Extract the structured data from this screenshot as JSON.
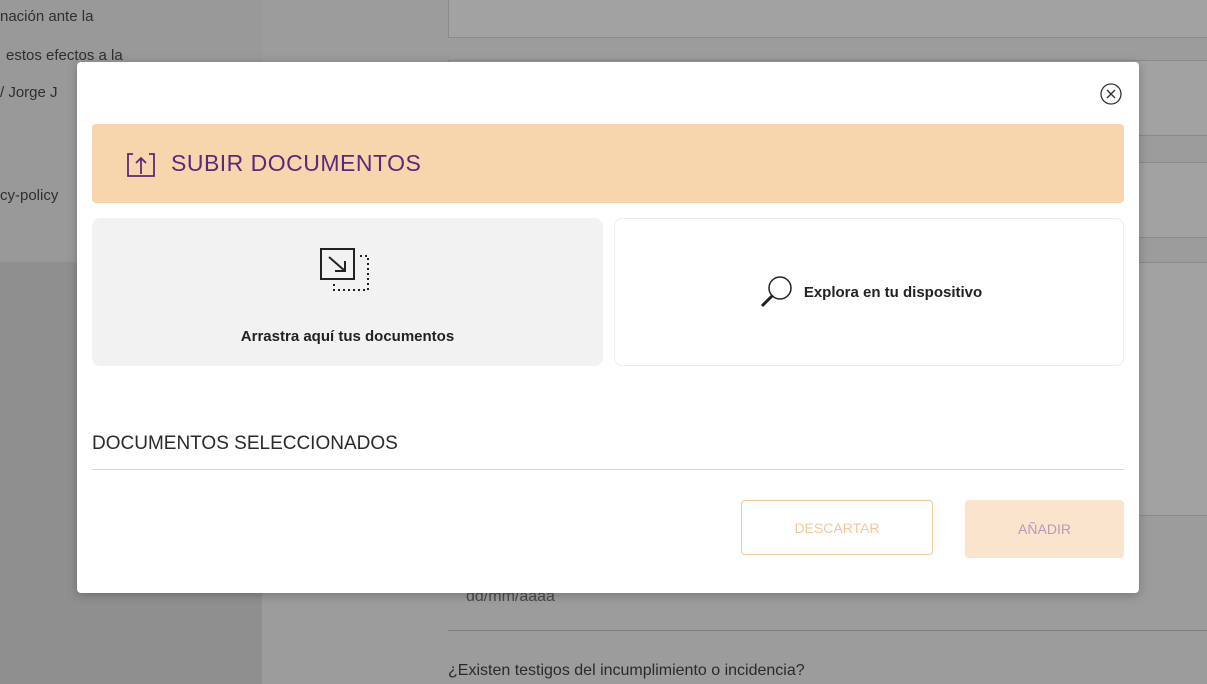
{
  "background": {
    "left_texts": [
      "nación ante la",
      "estos efectos a la",
      "/ Jorge J",
      "cy-policy"
    ],
    "date_placeholder": "dd/mm/aaaa",
    "question": "¿Existen testigos del incumplimiento o incidencia?"
  },
  "modal": {
    "close_icon": "close-circle-icon",
    "header": {
      "icon": "upload-icon",
      "title": "SUBIR DOCUMENTOS"
    },
    "drop_zone": {
      "icon": "drag-drop-icon",
      "label": "Arrastra aquí tus documentos"
    },
    "browse": {
      "icon": "search-icon",
      "label": "Explora en tu dispositivo"
    },
    "selected_section_title": "DOCUMENTOS SELECCIONADOS",
    "buttons": {
      "discard": "DESCARTAR",
      "add": "AÑADIR"
    }
  },
  "colors": {
    "header_bg": "#f7d6ad",
    "header_text": "#5a2a7a",
    "discard_border": "#f2c79c",
    "add_bg": "#fbe4cd"
  }
}
